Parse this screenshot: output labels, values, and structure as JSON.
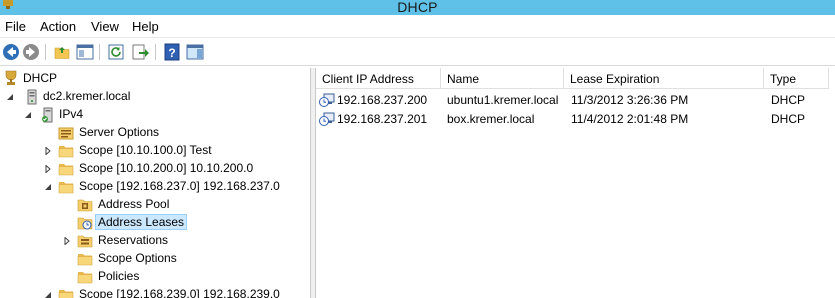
{
  "window": {
    "title": "DHCP"
  },
  "menu": {
    "file": "File",
    "action": "Action",
    "view": "View",
    "help": "Help"
  },
  "toolbar": {
    "buttons": [
      "back-icon",
      "forward-icon",
      "up-folder-icon",
      "show-hide-tree-icon",
      "refresh-icon",
      "export-list-icon",
      "help-icon",
      "action-pane-icon"
    ]
  },
  "tree": {
    "root": "DHCP",
    "server": "dc2.kremer.local",
    "ipv4": "IPv4",
    "server_options": "Server Options",
    "scope1": "Scope [10.10.100.0] Test",
    "scope2": "Scope [10.10.200.0] 10.10.200.0",
    "scope3": "Scope [192.168.237.0] 192.168.237.0",
    "address_pool": "Address Pool",
    "address_leases": "Address Leases",
    "reservations": "Reservations",
    "scope_options": "Scope Options",
    "policies": "Policies",
    "scope4": "Scope [192.168.239.0] 192.168.239.0"
  },
  "list": {
    "columns": [
      "Client IP Address",
      "Name",
      "Lease Expiration",
      "Type"
    ],
    "rows": [
      {
        "ip": "192.168.237.200",
        "name": "ubuntu1.kremer.local",
        "expiration": "11/3/2012 3:26:36 PM",
        "type": "DHCP"
      },
      {
        "ip": "192.168.237.201",
        "name": "box.kremer.local",
        "expiration": "11/4/2012 2:01:48 PM",
        "type": "DHCP"
      }
    ]
  },
  "colors": {
    "titlebar": "#5fc1e8",
    "selection": "#cce8ff",
    "folder": "#f4cf6b"
  }
}
